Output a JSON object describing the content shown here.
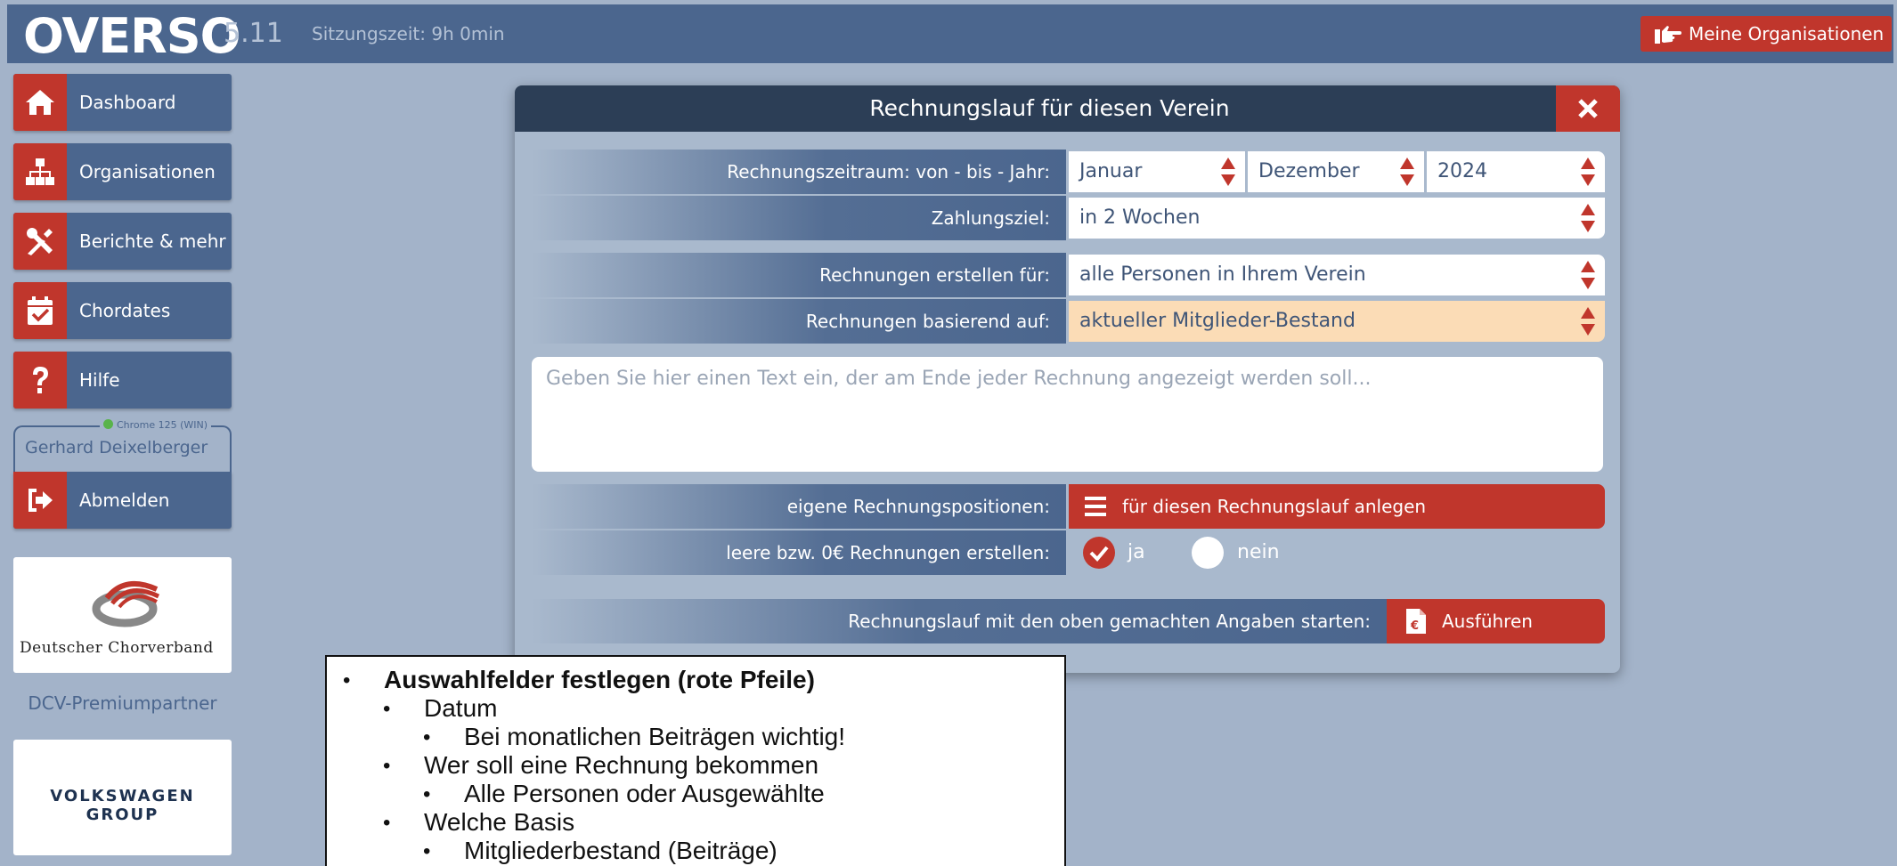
{
  "header": {
    "logo": "OVERSO",
    "version": "5.11",
    "session": "Sitzungszeit: 9h 0min",
    "org_button": "Meine Organisationen"
  },
  "sidebar": {
    "items": [
      {
        "label": "Dashboard",
        "icon": "home-icon"
      },
      {
        "label": "Organisationen",
        "icon": "sitemap-icon"
      },
      {
        "label": "Berichte & mehr",
        "icon": "tools-icon"
      },
      {
        "label": "Chordates",
        "icon": "calendar-check-icon"
      },
      {
        "label": "Hilfe",
        "icon": "question-icon"
      }
    ],
    "browser": "Chrome 125 (WIN)",
    "user": "Gerhard Deixelberger",
    "logout": "Abmelden",
    "sponsor1": "Deutscher Chorverband",
    "premium": "DCV-Premiumpartner",
    "sponsor2": "VOLKSWAGEN GROUP"
  },
  "modal": {
    "title": "Rechnungslauf für diesen Verein",
    "period_label": "Rechnungszeitraum: von - bis - Jahr:",
    "from": "Januar",
    "to": "Dezember",
    "year": "2024",
    "due_label": "Zahlungsziel:",
    "due": "in 2 Wochen",
    "for_label": "Rechnungen erstellen für:",
    "for_value": "alle Personen in Ihrem Verein",
    "basis_label": "Rechnungen basierend auf:",
    "basis_value": "aktueller Mitglieder-Bestand",
    "text_placeholder": "Geben Sie hier einen Text ein, der am Ende jeder Rechnung angezeigt werden soll...",
    "positions_label": "eigene Rechnungspositionen:",
    "positions_button": "für diesen Rechnungslauf anlegen",
    "empty_label": "leere bzw. 0€ Rechnungen erstellen:",
    "yes": "ja",
    "no": "nein",
    "start_label": "Rechnungslauf mit den oben gemachten Angaben starten:",
    "execute": "Ausführen"
  },
  "notes": {
    "l1": "Auswahlfelder festlegen (rote Pfeile)",
    "l2": "Datum",
    "l3": "Bei monatlichen Beiträgen wichtig!",
    "l4": "Wer soll eine Rechnung bekommen",
    "l5": "Alle Personen oder Ausgewählte",
    "l6": "Welche Basis",
    "l7": "Mitgliederbestand (Beiträge)"
  },
  "colors": {
    "accent": "#c0362c",
    "primary": "#4b668e",
    "dark": "#2c3e56",
    "highlight": "#fbdcb6"
  }
}
